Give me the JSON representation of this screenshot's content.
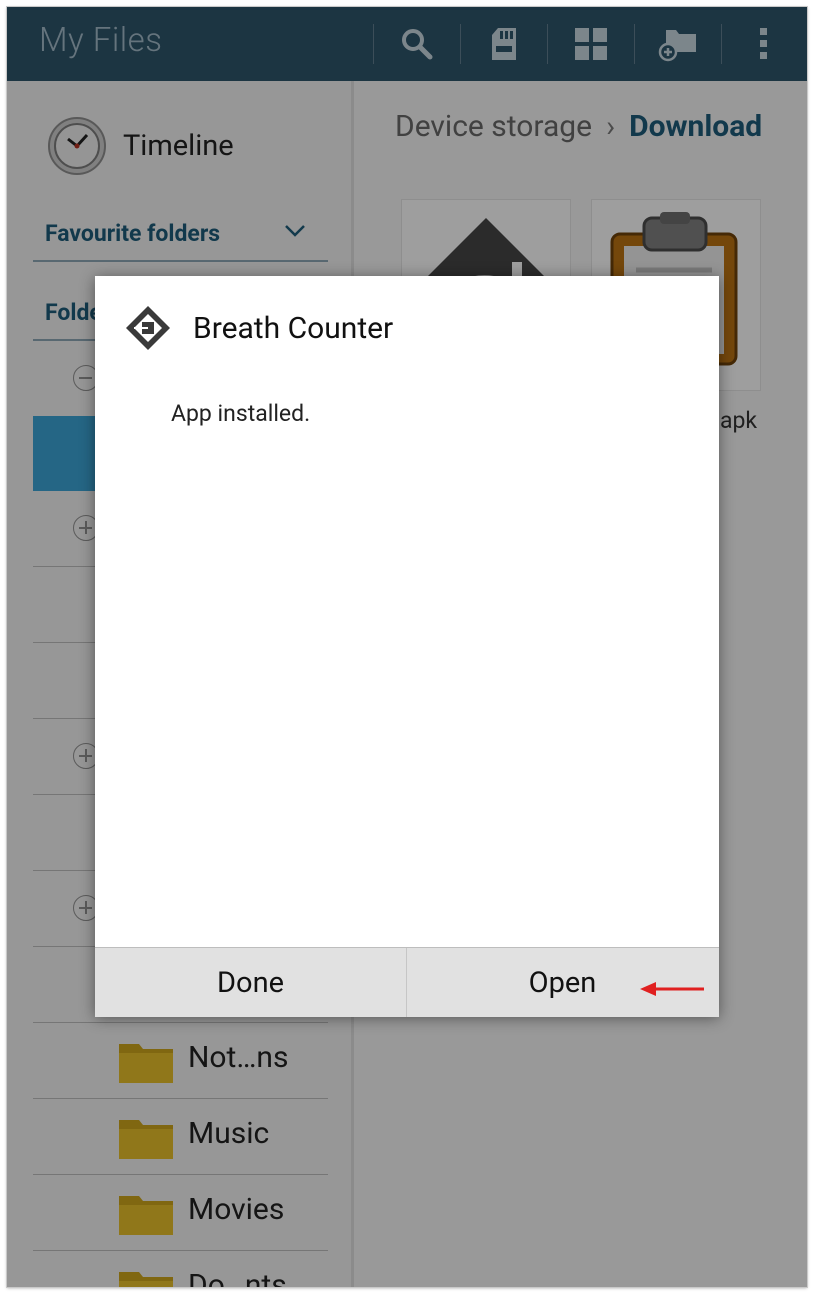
{
  "actionbar": {
    "title": "My Files",
    "actions": [
      {
        "icon": "search-icon"
      },
      {
        "icon": "sd-card-icon"
      },
      {
        "icon": "grid-view-icon"
      },
      {
        "icon": "new-folder-icon"
      },
      {
        "icon": "overflow-menu-icon"
      }
    ]
  },
  "sidebar": {
    "timeline_label": "Timeline",
    "favourites_label": "Favourite folders",
    "folders_label": "Folde",
    "folders": [
      {
        "name": "Not…ns"
      },
      {
        "name": "Music"
      },
      {
        "name": "Movies"
      },
      {
        "name": "Do…nts"
      }
    ]
  },
  "main": {
    "breadcrumb": {
      "root": "Device storage",
      "separator": "›",
      "current": "Download"
    },
    "visible_file_label_fragment": "apk"
  },
  "dialog": {
    "title": "Breath Counter",
    "message": "App installed.",
    "done_label": "Done",
    "open_label": "Open"
  },
  "colors": {
    "actionbar": "#2d5368",
    "accent": "#1d5a77",
    "selection": "#3aa0d0",
    "annotation_arrow": "#e02020"
  }
}
